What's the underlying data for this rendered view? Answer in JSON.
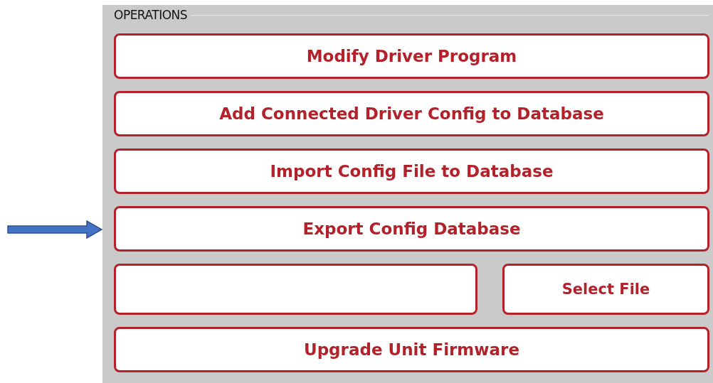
{
  "group": {
    "title": "OPERATIONS"
  },
  "items": [
    {
      "kind": "button",
      "label": "Modify Driver Program",
      "pointed": false
    },
    {
      "kind": "button",
      "label": "Add Connected Driver Config to Database",
      "pointed": false
    },
    {
      "kind": "button",
      "label": "Import Config File to Database",
      "pointed": false
    },
    {
      "kind": "button",
      "label": "Export Config Database",
      "pointed": true
    },
    {
      "kind": "file_row",
      "label": "Select File",
      "pointed": false
    },
    {
      "kind": "button",
      "label": "Upgrade Unit Firmware",
      "pointed": false
    }
  ]
}
